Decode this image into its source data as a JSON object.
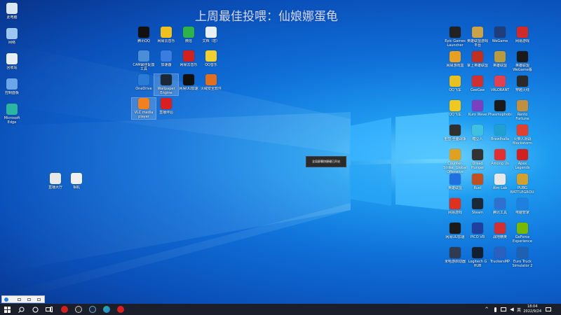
{
  "overlay_title": "上周最佳投喂：仙娘娜蛋龟",
  "toast_text": "全局屏幕快捷键已开启",
  "desktop": {
    "col0": [
      {
        "label": "此电脑",
        "color": "#d9e6f5"
      },
      {
        "label": "网络",
        "color": "#9cc7f0"
      },
      {
        "label": "回收站",
        "color": "#e8eef6"
      },
      {
        "label": "控制面板",
        "color": "#6aa6e8"
      },
      {
        "label": "Microsoft Edge",
        "color": "#2bb5a3"
      }
    ],
    "mid_grid": [
      {
        "label": "腾讯QQ",
        "color": "#111111"
      },
      {
        "label": "网易云音乐",
        "color": "#f0c020"
      },
      {
        "label": "微信",
        "color": "#2eb34a"
      },
      {
        "label": "文档（宏）",
        "color": "#e8eef6"
      },
      {
        "label": "CAM最佳配置工具",
        "color": "#4a8ed8"
      },
      {
        "label": "加速器",
        "color": "#3a7de0"
      },
      {
        "label": "网易云音乐",
        "color": "#d02020"
      },
      {
        "label": "QQ音乐",
        "color": "#f0d030"
      },
      {
        "label": "OneDrive",
        "color": "#2a7bd6"
      },
      {
        "label": "Wallpaper Engine",
        "color": "#1b2838"
      },
      {
        "label": "网易UU加速",
        "color": "#101010"
      },
      {
        "label": "火绒安全软件",
        "color": "#e07020"
      },
      {
        "label": "VLC media player",
        "color": "#f08020"
      },
      {
        "label": "直播伴侣",
        "color": "#d82020"
      }
    ],
    "lower_left": [
      {
        "label": "直播大厅",
        "color": "#e8e8e8"
      },
      {
        "label": "相机",
        "color": "#f0f0f0"
      }
    ],
    "right_grid": [
      {
        "label": "Epic Games Launcher",
        "color": "#222222"
      },
      {
        "label": "英雄联盟游戏平台",
        "color": "#caa24a"
      },
      {
        "label": "WeGame",
        "color": "#1f3e7a"
      },
      {
        "label": "网易游戏",
        "color": "#d02a2a"
      },
      {
        "label": "网易游戏盒",
        "color": "#e8a020"
      },
      {
        "label": "掌上英雄联盟",
        "color": "#c03020"
      },
      {
        "label": "英雄联盟",
        "color": "#b89a40"
      },
      {
        "label": "英雄联盟WeGame版",
        "color": "#1a1a1a"
      },
      {
        "label": "QQ飞车",
        "color": "#e8c020"
      },
      {
        "label": "GeeGee",
        "color": "#d03030"
      },
      {
        "label": "VALORANT",
        "color": "#e04050"
      },
      {
        "label": "穿越火线",
        "color": "#2a2a2a"
      },
      {
        "label": "QQ飞车",
        "color": "#f0c820"
      },
      {
        "label": "Kuro Wave",
        "color": "#7a40c0"
      },
      {
        "label": "Phasmophobia",
        "color": "#1a1a1a"
      },
      {
        "label": "Rento Fortune",
        "color": "#c09040"
      },
      {
        "label": "重塑·全面战争",
        "color": "#303030"
      },
      {
        "label": "糖豆人",
        "color": "#40c0e0"
      },
      {
        "label": "Brawlhalla",
        "color": "#20a0d0"
      },
      {
        "label": "火柴人对战Blockstorm",
        "color": "#e04030"
      },
      {
        "label": "Counter-Strike: Global Offensive",
        "color": "#e0a020"
      },
      {
        "label": "Dread Hunger",
        "color": "#333333"
      },
      {
        "label": "Among Us",
        "color": "#e03030"
      },
      {
        "label": "Apex Legends",
        "color": "#d02020"
      },
      {
        "label": "英雄联盟",
        "color": "#2070e0"
      },
      {
        "label": "Rust",
        "color": "#c05020"
      },
      {
        "label": "Aim Lab",
        "color": "#e8e8e8"
      },
      {
        "label": "PUBG BATTLEGROUNDS",
        "color": "#d0a030"
      },
      {
        "label": "网易游戏",
        "color": "#e03020"
      },
      {
        "label": "Steam",
        "color": "#1b2838"
      },
      {
        "label": "腾讯工具",
        "color": "#3070d0"
      },
      {
        "label": "电脑管家",
        "color": "#2080e0"
      },
      {
        "label": "网易UU加速",
        "color": "#1a1a1a"
      },
      {
        "label": "PICO VR",
        "color": "#2040a0"
      },
      {
        "label": "战地精英",
        "color": "#d03030"
      },
      {
        "label": "GeForce Experience",
        "color": "#76b900"
      },
      {
        "label": "米哈游启动器",
        "color": "#303a50"
      },
      {
        "label": "Logitech G HUB",
        "color": "#102030"
      },
      {
        "label": "TruckersMP",
        "color": "#2a60c0"
      },
      {
        "label": "Euro Truck Simulator 2",
        "color": "#2060b0"
      }
    ]
  },
  "taskbar": {
    "time": "18:04",
    "date": "2022/9/24"
  }
}
